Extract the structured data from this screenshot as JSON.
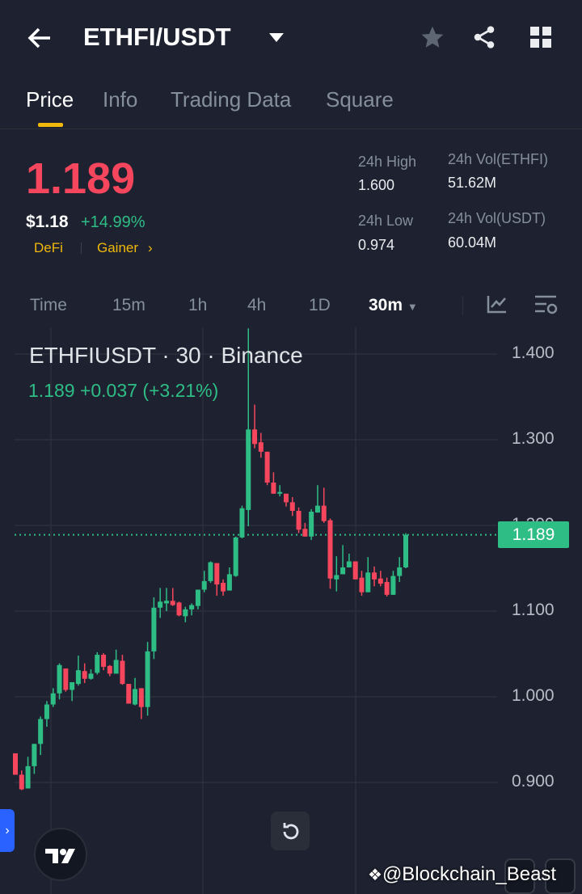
{
  "header": {
    "title": "ETHFI/USDT"
  },
  "tabs": [
    {
      "label": "Price"
    },
    {
      "label": "Info"
    },
    {
      "label": "Trading Data"
    },
    {
      "label": "Square"
    }
  ],
  "ticker": {
    "last": "1.189",
    "usd": "$1.18",
    "change": "+14.99%",
    "tags": [
      "DeFi",
      "Gainer"
    ],
    "high_label": "24h High",
    "high": "1.600",
    "low_label": "24h Low",
    "low": "0.974",
    "vol_base_label": "24h Vol(ETHFI)",
    "vol_base": "51.62M",
    "vol_quote_label": "24h Vol(USDT)",
    "vol_quote": "60.04M"
  },
  "intervals": [
    "Time",
    "15m",
    "1h",
    "4h",
    "1D",
    "30m"
  ],
  "chart_legend": {
    "title": "ETHFIUSDT · 30 · Binance",
    "values": "1.189  +0.037 (+3.21%)"
  },
  "watermark": "@Blockchain_Beast",
  "colors": {
    "up": "#2ebd85",
    "down": "#f6465d",
    "accent": "#f0b90b"
  },
  "chart_data": {
    "type": "candlestick",
    "symbol": "ETHFIUSDT",
    "interval": "30",
    "ylim": [
      0.86,
      1.43
    ],
    "yticks": [
      "1.400",
      "1.300",
      "1.200",
      "1.100",
      "1.000",
      "0.900"
    ],
    "ytick_values": [
      1.4,
      1.3,
      1.2,
      1.1,
      1.0,
      0.9
    ],
    "last_price": 1.189,
    "last_label": "1.189",
    "ohlc": [
      [
        0.934,
        0.934,
        0.909,
        0.909
      ],
      [
        0.909,
        0.914,
        0.891,
        0.892
      ],
      [
        0.893,
        0.93,
        0.893,
        0.919
      ],
      [
        0.919,
        0.945,
        0.91,
        0.945
      ],
      [
        0.945,
        0.977,
        0.932,
        0.974
      ],
      [
        0.974,
        0.995,
        0.965,
        0.991
      ],
      [
        0.991,
        1.01,
        0.988,
        1.004
      ],
      [
        1.004,
        1.039,
        0.997,
        1.037
      ],
      [
        1.033,
        1.033,
        1.006,
        1.008
      ],
      [
        1.008,
        1.017,
        0.995,
        1.017
      ],
      [
        1.015,
        1.048,
        1.013,
        1.031
      ],
      [
        1.03,
        1.039,
        1.016,
        1.021
      ],
      [
        1.021,
        1.032,
        1.02,
        1.027
      ],
      [
        1.028,
        1.052,
        1.026,
        1.049
      ],
      [
        1.049,
        1.051,
        1.031,
        1.035
      ],
      [
        1.036,
        1.037,
        1.024,
        1.027
      ],
      [
        1.027,
        1.055,
        1.027,
        1.043
      ],
      [
        1.042,
        1.049,
        1.014,
        1.015
      ],
      [
        1.015,
        1.015,
        0.992,
        0.992
      ],
      [
        0.991,
        1.022,
        0.99,
        1.009
      ],
      [
        1.01,
        1.01,
        0.974,
        0.988
      ],
      [
        0.988,
        1.064,
        0.978,
        1.053
      ],
      [
        1.053,
        1.116,
        1.044,
        1.104
      ],
      [
        1.104,
        1.127,
        1.092,
        1.111
      ],
      [
        1.109,
        1.127,
        1.1,
        1.112
      ],
      [
        1.112,
        1.127,
        1.106,
        1.107
      ],
      [
        1.11,
        1.111,
        1.094,
        1.095
      ],
      [
        1.094,
        1.105,
        1.087,
        1.102
      ],
      [
        1.102,
        1.109,
        1.095,
        1.107
      ],
      [
        1.106,
        1.125,
        1.102,
        1.125
      ],
      [
        1.125,
        1.147,
        1.122,
        1.135
      ],
      [
        1.135,
        1.158,
        1.133,
        1.157
      ],
      [
        1.156,
        1.156,
        1.118,
        1.131
      ],
      [
        1.133,
        1.137,
        1.118,
        1.123
      ],
      [
        1.124,
        1.151,
        1.124,
        1.143
      ],
      [
        1.141,
        1.187,
        1.14,
        1.186
      ],
      [
        1.186,
        1.223,
        1.185,
        1.22
      ],
      [
        1.218,
        1.43,
        1.199,
        1.312
      ],
      [
        1.312,
        1.341,
        1.29,
        1.295
      ],
      [
        1.297,
        1.308,
        1.279,
        1.286
      ],
      [
        1.286,
        1.286,
        1.247,
        1.25
      ],
      [
        1.25,
        1.262,
        1.237,
        1.237
      ],
      [
        1.237,
        1.247,
        1.234,
        1.239
      ],
      [
        1.237,
        1.237,
        1.222,
        1.227
      ],
      [
        1.227,
        1.233,
        1.211,
        1.217
      ],
      [
        1.217,
        1.221,
        1.191,
        1.195
      ],
      [
        1.196,
        1.203,
        1.187,
        1.187
      ],
      [
        1.187,
        1.219,
        1.183,
        1.216
      ],
      [
        1.215,
        1.247,
        1.215,
        1.223
      ],
      [
        1.223,
        1.244,
        1.203,
        1.205
      ],
      [
        1.206,
        1.208,
        1.126,
        1.138
      ],
      [
        1.137,
        1.164,
        1.123,
        1.142
      ],
      [
        1.143,
        1.177,
        1.143,
        1.151
      ],
      [
        1.151,
        1.167,
        1.151,
        1.158
      ],
      [
        1.158,
        1.158,
        1.137,
        1.137
      ],
      [
        1.139,
        1.147,
        1.118,
        1.122
      ],
      [
        1.122,
        1.163,
        1.122,
        1.145
      ],
      [
        1.145,
        1.152,
        1.129,
        1.137
      ],
      [
        1.138,
        1.147,
        1.129,
        1.132
      ],
      [
        1.134,
        1.139,
        1.117,
        1.119
      ],
      [
        1.119,
        1.147,
        1.119,
        1.141
      ],
      [
        1.141,
        1.163,
        1.134,
        1.151
      ],
      [
        1.151,
        1.191,
        1.15,
        1.189
      ]
    ]
  }
}
